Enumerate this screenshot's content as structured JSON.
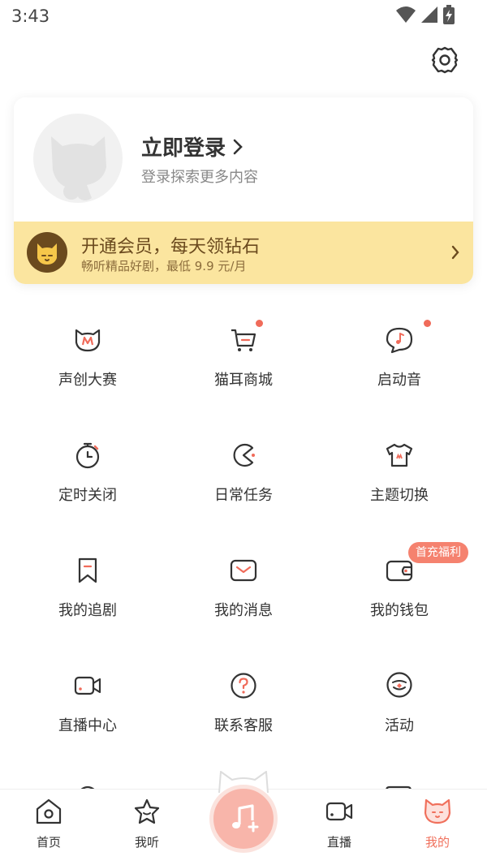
{
  "status_bar": {
    "time": "3:43"
  },
  "profile": {
    "login_title": "立即登录",
    "login_subtitle": "登录探索更多内容"
  },
  "vip": {
    "title": "开通会员，每天领钻石",
    "subtitle": "畅听精品好剧，最低 9.9 元/月"
  },
  "grid": [
    {
      "label": "声创大赛",
      "icon": "cat-m-icon"
    },
    {
      "label": "猫耳商城",
      "icon": "cart-icon"
    },
    {
      "label": "启动音",
      "icon": "music-bubble-icon"
    },
    {
      "label": "定时关闭",
      "icon": "timer-icon"
    },
    {
      "label": "日常任务",
      "icon": "pacman-icon"
    },
    {
      "label": "主题切换",
      "icon": "tshirt-icon"
    },
    {
      "label": "我的追剧",
      "icon": "bookmark-icon"
    },
    {
      "label": "我的消息",
      "icon": "mail-icon"
    },
    {
      "label": "我的钱包",
      "icon": "wallet-icon"
    },
    {
      "label": "直播中心",
      "icon": "video-camera-icon"
    },
    {
      "label": "联系客服",
      "icon": "help-icon"
    },
    {
      "label": "活动",
      "icon": "activity-icon"
    }
  ],
  "wallet_badge": "首充福利",
  "tabbar": [
    {
      "label": "首页",
      "icon": "home-icon"
    },
    {
      "label": "我听",
      "icon": "star-icon"
    },
    {
      "label": "直播",
      "icon": "live-camera-icon"
    },
    {
      "label": "我的",
      "icon": "cat-face-icon"
    }
  ],
  "colors": {
    "accent": "#f0705c",
    "vip_bg": "#fbe59f",
    "dot": "#f06b5a"
  }
}
